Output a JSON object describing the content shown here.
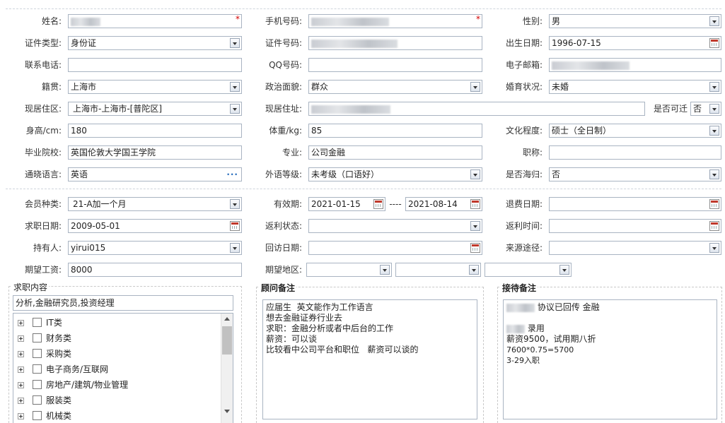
{
  "row1": {
    "name_label": "姓名:",
    "phone_label": "手机号码:",
    "gender_label": "性别:",
    "gender_value": "男"
  },
  "row2": {
    "idtype_label": "证件类型:",
    "idtype_value": "身份证",
    "idno_label": "证件号码:",
    "birth_label": "出生日期:",
    "birth_value": "1996-07-15"
  },
  "row3": {
    "contact_label": "联系电话:",
    "qq_label": "QQ号码:",
    "email_label": "电子邮箱:"
  },
  "row4": {
    "native_label": "籍贯:",
    "native_value": "上海市",
    "political_label": "政治面貌:",
    "political_value": "群众",
    "marital_label": "婚育状况:",
    "marital_value": "未婚"
  },
  "row5": {
    "residence_label": "现居住区:",
    "residence_value": "上海市-上海市-[普陀区]",
    "address_label": "现居住址:",
    "relocate_label": "是否可迁",
    "relocate_value": "否"
  },
  "row6": {
    "height_label": "身高/cm:",
    "height_value": "180",
    "weight_label": "体重/kg:",
    "weight_value": "85",
    "edu_label": "文化程度:",
    "edu_value": "硕士（全日制）"
  },
  "row7": {
    "school_label": "毕业院校:",
    "school_value": "英国伦敦大学国王学院",
    "major_label": "专业:",
    "major_value": "公司金融",
    "title_label": "职称:"
  },
  "row8": {
    "lang_label": "通晓语言:",
    "lang_value": "英语",
    "lang_level_label": "外语等级:",
    "lang_level_value": "未考级（口语好）",
    "returnee_label": "是否海归:",
    "returnee_value": "否"
  },
  "row9": {
    "member_label": "会员种类:",
    "member_value": "21-A加一个月",
    "valid_label": "有效期:",
    "valid_from": "2021-01-15",
    "valid_sep": "----",
    "valid_to": "2021-08-14",
    "refund_date_label": "退费日期:"
  },
  "row10": {
    "job_date_label": "求职日期:",
    "job_date_value": "2009-05-01",
    "rebate_status_label": "返利状态:",
    "rebate_time_label": "返利时间:"
  },
  "row11": {
    "holder_label": "持有人:",
    "holder_value": "yirui015",
    "visit_label": "回访日期:",
    "source_label": "来源途径:"
  },
  "row12": {
    "salary_label": "期望工资:",
    "salary_value": "8000",
    "region_label": "期望地区:"
  },
  "job_panel": {
    "title": "求职内容",
    "summary": "分析,金融研究员,投资经理",
    "items": [
      "IT类",
      "财务类",
      "采购类",
      "电子商务/互联网",
      "房地产/建筑/物业管理",
      "服装类",
      "机械类"
    ]
  },
  "advisor_panel": {
    "title": "顾问备注",
    "text": "应届生  英文能作为工作语言\n想去金融证券行业去\n求职：金融分析或者中后台的工作\n薪资：可以谈\n比较看中公司平台和职位   薪资可以谈的"
  },
  "reception_panel": {
    "title": "接待备注",
    "line1": "协议已回传 金融",
    "line2": "录用",
    "line3": "薪资9500，试用期八折",
    "line4": "7600*0.75=5700",
    "line5": "3-29入职"
  },
  "colors": {
    "required": "#d40000",
    "border": "#a9b4c2",
    "link": "#2b6fbd"
  }
}
